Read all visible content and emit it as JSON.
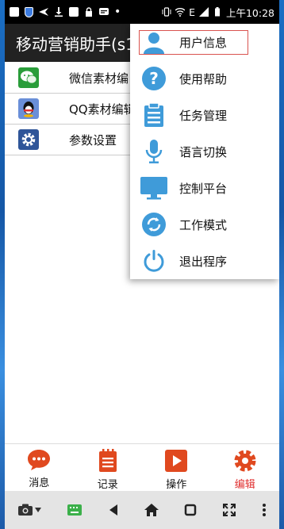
{
  "status_bar": {
    "time": "上午10:28",
    "network_label": "E"
  },
  "app": {
    "title": "移动营销助手(s1"
  },
  "list": [
    {
      "label": "微信素材编",
      "icon": "wechat-icon"
    },
    {
      "label": "QQ素材编辑",
      "icon": "qq-icon"
    },
    {
      "label": "参数设置",
      "icon": "settings-gear-icon"
    }
  ],
  "menu": {
    "items": [
      {
        "label": "用户信息",
        "icon": "user-icon"
      },
      {
        "label": "使用帮助",
        "icon": "help-icon"
      },
      {
        "label": "任务管理",
        "icon": "clipboard-icon"
      },
      {
        "label": "语言切换",
        "icon": "microphone-icon"
      },
      {
        "label": "控制平台",
        "icon": "monitor-icon"
      },
      {
        "label": "工作模式",
        "icon": "refresh-icon"
      },
      {
        "label": "退出程序",
        "icon": "power-icon"
      }
    ]
  },
  "tabs": [
    {
      "label": "消息",
      "icon": "chat-bubble-icon"
    },
    {
      "label": "记录",
      "icon": "notepad-icon"
    },
    {
      "label": "操作",
      "icon": "play-icon"
    },
    {
      "label": "编辑",
      "icon": "gear-icon",
      "active": true
    }
  ],
  "colors": {
    "accent": "#e03030",
    "menu_icon_blue": "#3f9bd9",
    "tab_icon_red": "#e0491f"
  }
}
